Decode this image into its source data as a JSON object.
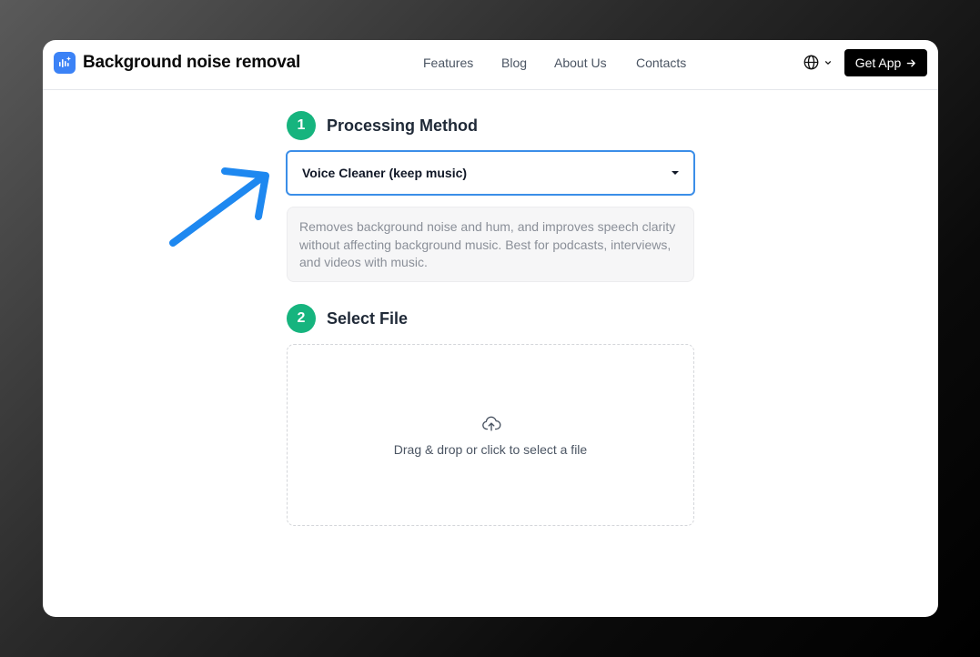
{
  "header": {
    "brand": "Background noise removal",
    "nav": [
      {
        "label": "Features"
      },
      {
        "label": "Blog"
      },
      {
        "label": "About Us"
      },
      {
        "label": "Contacts"
      }
    ],
    "cta_label": "Get App"
  },
  "steps": [
    {
      "number": "1",
      "title": "Processing Method"
    },
    {
      "number": "2",
      "title": "Select File"
    }
  ],
  "method_select": {
    "value": "Voice Cleaner (keep music)"
  },
  "method_description": "Removes background noise and hum, and improves speech clarity without affecting background music. Best for podcasts, interviews, and videos with music.",
  "dropzone": {
    "text": "Drag & drop or click to select a file"
  },
  "colors": {
    "accent_green": "#16b47e",
    "focus_blue": "#3b8ee8",
    "annotation_arrow": "#1e88f0",
    "logo_blue": "#3b82f6"
  },
  "icons": {
    "logo": "sound-wave-sparkle-icon",
    "language": "globe-icon",
    "cta": "arrow-right-icon",
    "upload": "cloud-upload-icon",
    "annotation": "annotation-arrow-icon"
  }
}
